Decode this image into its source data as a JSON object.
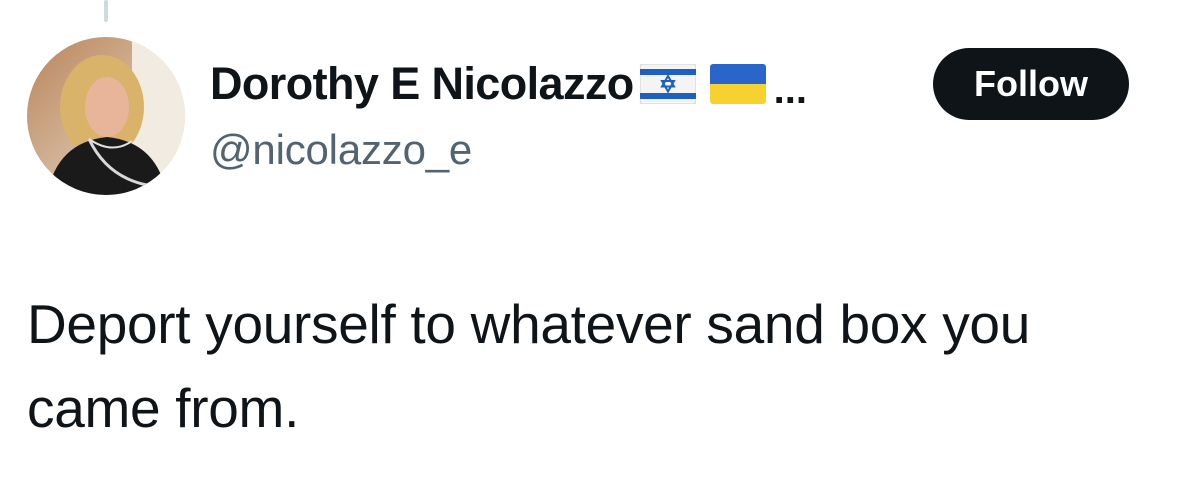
{
  "user": {
    "display_name": "Dorothy E Nicolazzo",
    "flags": [
      "israel-flag",
      "ukraine-flag"
    ],
    "truncation": "...",
    "handle": "@nicolazzo_e"
  },
  "actions": {
    "follow_label": "Follow"
  },
  "tweet": {
    "text": "Deport yourself to whatever sand box you came from."
  },
  "colors": {
    "text_primary": "#0f1419",
    "text_secondary": "#536471",
    "follow_bg": "#0f1419",
    "follow_text": "#ffffff",
    "thread_line": "#cfd9de"
  }
}
